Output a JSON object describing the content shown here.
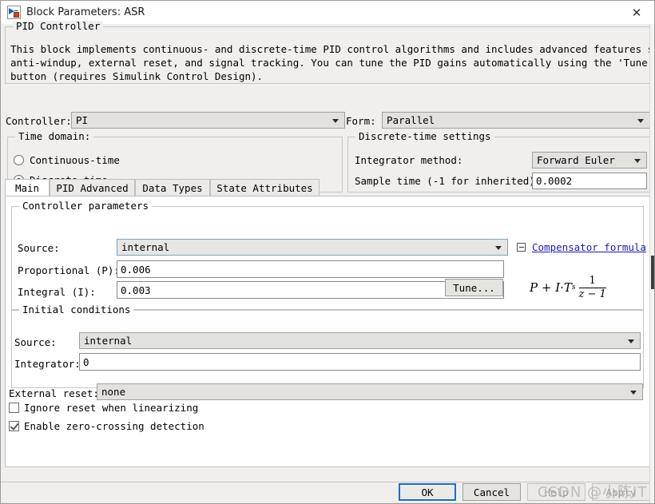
{
  "window": {
    "title": "Block Parameters: ASR",
    "icon": "simulink-block-icon",
    "close_label": "✕"
  },
  "description_group": {
    "legend": "PID Controller",
    "text": "This block implements continuous- and discrete-time PID control algorithms and includes advanced features such as\nanti-windup, external reset, and signal tracking. You can tune the PID gains automatically using the 'Tune...'\nbutton (requires Simulink Control Design)."
  },
  "top": {
    "controller_label": "Controller:",
    "controller_value": "PI",
    "form_label": "Form:",
    "form_value": "Parallel",
    "time_domain": {
      "legend": "Time domain:",
      "options": [
        {
          "label": "Continuous-time",
          "selected": false
        },
        {
          "label": "Discrete-time",
          "selected": true
        }
      ]
    },
    "discrete_settings": {
      "legend": "Discrete-time settings",
      "integrator_method_label": "Integrator method:",
      "integrator_method_value": "Forward Euler",
      "sample_time_label": "Sample time (-1 for inherited):",
      "sample_time_value": "0.0002"
    }
  },
  "tabs": [
    {
      "label": "Main",
      "active": true
    },
    {
      "label": "PID Advanced",
      "active": false
    },
    {
      "label": "Data Types",
      "active": false
    },
    {
      "label": "State Attributes",
      "active": false
    }
  ],
  "controller_parameters": {
    "legend": "Controller parameters",
    "source_label": "Source:",
    "source_value": "internal",
    "proportional_label": "Proportional (P):",
    "proportional_value": "0.006",
    "integral_label": "Integral (I):",
    "integral_value": "0.003",
    "tune_button": "Tune...",
    "compensator": {
      "link": "Compensator formula",
      "formula_lead": "P + I·T",
      "formula_sub": "s",
      "formula_numerator": "1",
      "formula_denominator": "z − 1"
    }
  },
  "initial_conditions": {
    "legend": "Initial conditions",
    "source_label": "Source:",
    "source_value": "internal",
    "integrator_label": "Integrator:",
    "integrator_value": "0"
  },
  "external_reset": {
    "label": "External reset:",
    "value": "none"
  },
  "checkboxes": [
    {
      "label": "Ignore reset when linearizing",
      "checked": false
    },
    {
      "label": "Enable zero-crossing detection",
      "checked": true
    }
  ],
  "footer": {
    "ok": "OK",
    "cancel": "Cancel",
    "help": "Help",
    "apply": "Apply"
  },
  "watermark": "CSDN @小陈IT",
  "colors": {
    "accent": "#1b6fc4",
    "link": "#1a1ab4",
    "dialog_bg": "#f0efee",
    "panel_bg": "#ffffff"
  }
}
